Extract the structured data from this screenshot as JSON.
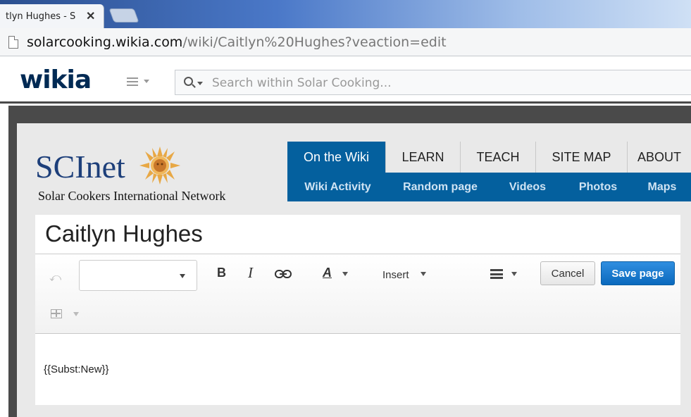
{
  "browser": {
    "tab_title": "tlyn Hughes - S",
    "url_host": "solarcooking.wikia.com",
    "url_path": "/wiki/Caitlyn%20Hughes?veaction=edit"
  },
  "wikia": {
    "logo": "wikia",
    "search_placeholder": "Search within Solar Cooking..."
  },
  "site": {
    "logo_title": "SCInet",
    "logo_subtitle": "Solar Cookers International Network"
  },
  "nav": {
    "tabs": [
      "On the Wiki",
      "LEARN",
      "TEACH",
      "SITE MAP",
      "ABOUT"
    ],
    "subitems": [
      "Wiki Activity",
      "Random page",
      "Videos",
      "Photos",
      "Maps"
    ]
  },
  "editor": {
    "page_title": "Caitlyn Hughes",
    "bold": "B",
    "italic": "I",
    "style": "A",
    "insert": "Insert",
    "cancel": "Cancel",
    "save": "Save page",
    "body": "{{Subst:New}}"
  },
  "colors": {
    "nav_blue": "#04609e",
    "save_blue": "#0a69bd",
    "logo_navy": "#1d3f7a",
    "sun_orange": "#e8a845"
  },
  "icons": [
    "close-icon",
    "page-icon",
    "hamburger-icon",
    "search-icon",
    "sun-logo-icon",
    "undo-icon",
    "link-icon",
    "list-icon",
    "table-icon"
  ]
}
